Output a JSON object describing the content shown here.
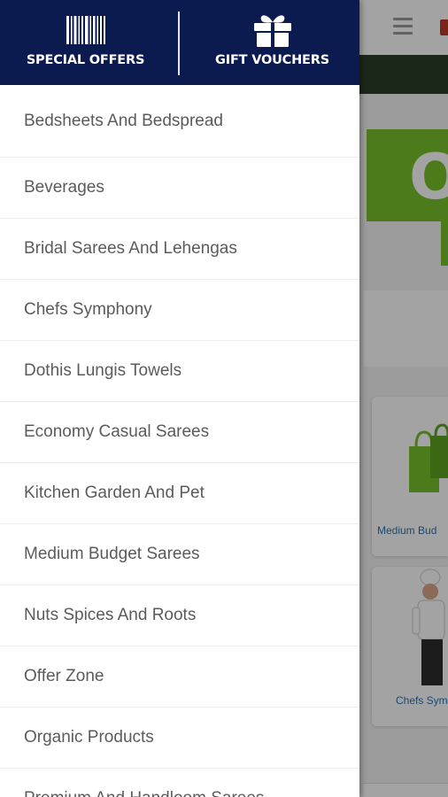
{
  "drawer": {
    "header": {
      "special_offers_label": "SPECIAL OFFERS",
      "special_offers_icon": "barcode-icon",
      "gift_vouchers_label": "GIFT VOUCHERS",
      "gift_vouchers_icon": "gift-icon",
      "background_color": "#0b1a4f"
    },
    "items": [
      {
        "label": "Bedsheets And Bedspread"
      },
      {
        "label": "Beverages"
      },
      {
        "label": "Bridal Sarees And Lehengas"
      },
      {
        "label": "Chefs Symphony"
      },
      {
        "label": "Dothis Lungis Towels"
      },
      {
        "label": "Economy Casual Sarees"
      },
      {
        "label": "Kitchen Garden And Pet"
      },
      {
        "label": "Medium Budget Sarees"
      },
      {
        "label": "Nuts Spices And Roots"
      },
      {
        "label": "Offer Zone"
      },
      {
        "label": "Organic Products"
      },
      {
        "label": "Premium And Handloom Sarees"
      }
    ]
  },
  "background": {
    "menu_icon": "hamburger-icon",
    "banner_text": "OF",
    "banner_color": "#76c12b",
    "cards": [
      {
        "label": "Medium Bud"
      },
      {
        "label": "Chefs Sym"
      }
    ]
  }
}
